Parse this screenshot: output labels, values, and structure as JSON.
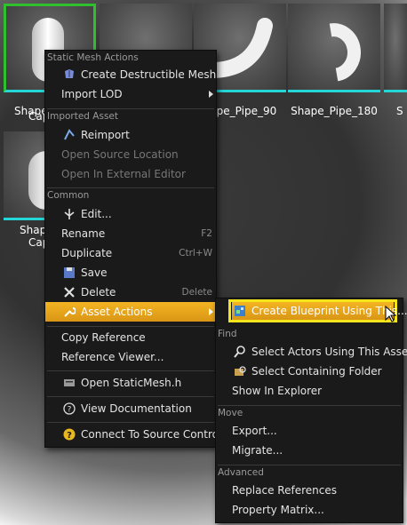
{
  "content_browser": {
    "tiles": [
      {
        "label": "Shape",
        "label2": "Cap",
        "selected": true
      },
      {
        "label": ""
      },
      {
        "label": "hape_Pipe_90"
      },
      {
        "label": "Shape_Pipe_180"
      },
      {
        "label": "S"
      },
      {
        "label": "Shap",
        "label2": "Cap"
      }
    ]
  },
  "context_menu": {
    "sections": {
      "static_mesh": "Static Mesh Actions",
      "imported": "Imported Asset",
      "common": "Common"
    },
    "items": {
      "create_destructible": "Create Destructible Mesh",
      "import_lod": "Import LOD",
      "reimport": "Reimport",
      "open_source_location": "Open Source Location",
      "open_external_editor": "Open In External Editor",
      "edit": "Edit...",
      "rename": "Rename",
      "rename_sc": "F2",
      "duplicate": "Duplicate",
      "duplicate_sc": "Ctrl+W",
      "save": "Save",
      "delete": "Delete",
      "delete_sc": "Delete",
      "asset_actions": "Asset Actions",
      "copy_reference": "Copy Reference",
      "reference_viewer": "Reference Viewer...",
      "open_static_mesh_h": "Open StaticMesh.h",
      "view_documentation": "View Documentation",
      "connect_source_control": "Connect To Source Control"
    }
  },
  "submenu": {
    "create_blueprint": "Create Blueprint Using This...",
    "sections": {
      "find": "Find",
      "move": "Move",
      "advanced": "Advanced"
    },
    "items": {
      "select_actors": "Select Actors Using This Asset",
      "select_folder": "Select Containing Folder",
      "show_explorer": "Show In Explorer",
      "export": "Export...",
      "migrate": "Migrate...",
      "replace_refs": "Replace References",
      "property_matrix": "Property Matrix..."
    }
  },
  "colors": {
    "highlight": "#e8a51c",
    "selection_border": "#2fbf2f",
    "thumb_strip": "#25d6d6",
    "callout": "#f5e51a"
  }
}
